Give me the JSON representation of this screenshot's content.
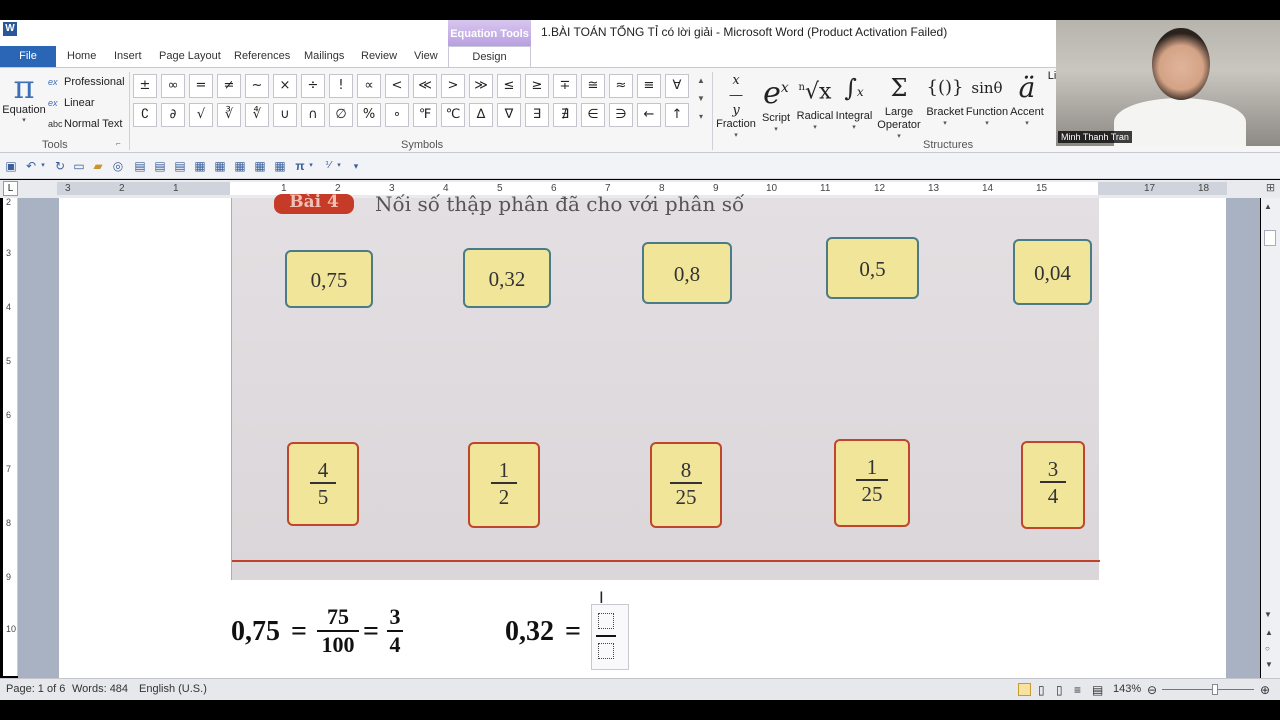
{
  "titlebar": {
    "context_tab_group": "Equation Tools",
    "title": "1.BÀI TOÁN TỔNG TỈ có lời giải  -  Microsoft Word (Product Activation Failed)"
  },
  "tabs": [
    "File",
    "Home",
    "Insert",
    "Page Layout",
    "References",
    "Mailings",
    "Review",
    "View",
    "Design"
  ],
  "ribbon": {
    "tools": {
      "equation_label": "Equation",
      "options": [
        "Professional",
        "Linear",
        "Normal Text"
      ],
      "group_label": "Tools"
    },
    "symbols": {
      "row1": [
        "±",
        "∞",
        "=",
        "≠",
        "~",
        "×",
        "÷",
        "!",
        "∝",
        "<",
        "≪",
        ">",
        "≫",
        "≤",
        "≥",
        "∓",
        "≅",
        "≈",
        "≡",
        "∀"
      ],
      "row2": [
        "∁",
        "∂",
        "√",
        "∛",
        "∜",
        "∪",
        "∩",
        "∅",
        "%",
        "∘",
        "℉",
        "℃",
        "∆",
        "∇",
        "∃",
        "∄",
        "∈",
        "∋",
        "←",
        "↑"
      ],
      "group_label": "Symbols"
    },
    "structures": {
      "items": [
        {
          "label": "Fraction",
          "glyph": "x/y"
        },
        {
          "label": "Script",
          "glyph": "eˣ"
        },
        {
          "label": "Radical",
          "glyph": "ⁿ√x"
        },
        {
          "label": "Integral",
          "glyph": "∫"
        },
        {
          "label": "Large Operator",
          "glyph": "Σ"
        },
        {
          "label": "Bracket",
          "glyph": "{()}"
        },
        {
          "label": "Function",
          "glyph": "sinθ"
        },
        {
          "label": "Accent",
          "glyph": "ä"
        },
        {
          "label": "Li",
          "glyph": ""
        }
      ],
      "group_label": "Structures"
    }
  },
  "ruler": {
    "numbers": [
      "3",
      "2",
      "1",
      "1",
      "2",
      "3",
      "4",
      "5",
      "6",
      "7",
      "8",
      "9",
      "10",
      "11",
      "12",
      "13",
      "14",
      "15",
      "17",
      "18"
    ],
    "vertical": [
      "2",
      "3",
      "4",
      "5",
      "6",
      "7",
      "8",
      "9",
      "10"
    ]
  },
  "document": {
    "exercise_badge": "Bài 4",
    "exercise_text": "Nối số thập phân đã cho với phân số",
    "decimals": [
      "0,75",
      "0,32",
      "0,8",
      "0,5",
      "0,04"
    ],
    "fractions": [
      {
        "num": "4",
        "den": "5"
      },
      {
        "num": "1",
        "den": "2"
      },
      {
        "num": "8",
        "den": "25"
      },
      {
        "num": "1",
        "den": "25"
      },
      {
        "num": "3",
        "den": "4"
      }
    ],
    "equation1": {
      "lhs": "0,75",
      "eq": "=",
      "f1_num": "75",
      "f1_den": "100",
      "eq2": "=",
      "f2_num": "3",
      "f2_den": "4"
    },
    "equation2": {
      "lhs": "0,32",
      "eq": "="
    }
  },
  "statusbar": {
    "page": "Page: 1 of 6",
    "words": "Words: 484",
    "language": "English (U.S.)",
    "zoom": "143%"
  },
  "webcam": {
    "name": "Minh Thanh Tran"
  },
  "colors": {
    "file_tab": "#2b65b5",
    "equation_tools": "#b9a0e0",
    "decimal_card_border": "#4a7b87",
    "fraction_card_border": "#c0452d",
    "card_fill": "#f1e599"
  }
}
